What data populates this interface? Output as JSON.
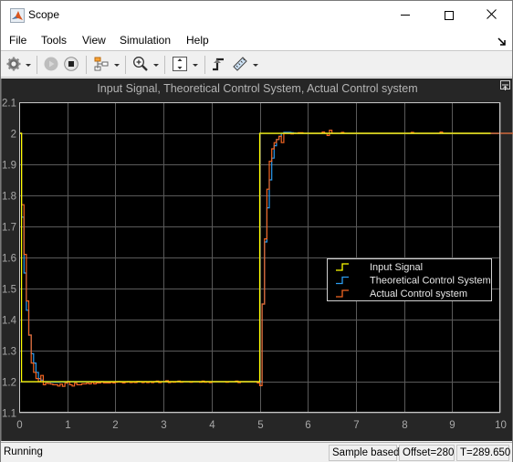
{
  "window": {
    "title": "Scope",
    "icon": "matlab-logo-icon",
    "controls": [
      "minimize",
      "maximize",
      "close"
    ]
  },
  "menubar": {
    "items": [
      {
        "label": "File"
      },
      {
        "label": "Tools"
      },
      {
        "label": "View"
      },
      {
        "label": "Simulation"
      },
      {
        "label": "Help"
      }
    ]
  },
  "toolbar": {
    "buttons": [
      {
        "icon": "settings-gear-icon",
        "dropdown": true
      },
      {
        "icon": "run-play-icon",
        "disabled": true
      },
      {
        "icon": "stop-icon"
      },
      {
        "icon": "signal-selector-icon",
        "dropdown": true
      },
      {
        "icon": "zoom-in-icon",
        "dropdown": true
      },
      {
        "icon": "scale-axes-icon",
        "dropdown": true
      },
      {
        "icon": "triggers-icon"
      },
      {
        "icon": "measurements-ruler-icon",
        "dropdown": true
      }
    ]
  },
  "status": {
    "state": "Running",
    "mode": "Sample based",
    "offset": "Offset=280",
    "time": "T=289.650"
  },
  "chart_data": {
    "type": "line",
    "title": "Input Signal, Theoretical Control System, Actual Control system",
    "xlabel": "",
    "ylabel": "",
    "xlim": [
      0,
      10
    ],
    "ylim": [
      1.1,
      2.1
    ],
    "xticks": [
      "0",
      "1",
      "2",
      "3",
      "4",
      "5",
      "6",
      "7",
      "8",
      "9",
      "10"
    ],
    "yticks": [
      "1.1",
      "1.2",
      "1.3",
      "1.4",
      "1.5",
      "1.6",
      "1.7",
      "1.8",
      "1.9",
      "2",
      "2.1"
    ],
    "grid": true,
    "legend_position": "right-middle",
    "step_style": "stairs",
    "sample_time": 0.05,
    "series": [
      {
        "name": "Input Signal",
        "color": "#ffff00",
        "points": [
          [
            0,
            2.0
          ],
          [
            0.05,
            2.0
          ],
          [
            0.05,
            1.2
          ],
          [
            5.0,
            1.2
          ],
          [
            5.0,
            2.0
          ],
          [
            9.8,
            2.0
          ]
        ]
      },
      {
        "name": "Theoretical Control System",
        "color": "#2b9cf0",
        "start": 0.0,
        "values": [
          2.0,
          1.73,
          1.55,
          1.43,
          1.35,
          1.29,
          1.26,
          1.23,
          1.21,
          1.205,
          1.2,
          1.2,
          1.199,
          1.198,
          1.198,
          1.198,
          1.198,
          1.199,
          1.199,
          1.199,
          1.2,
          1.2,
          1.2,
          1.2,
          1.2,
          1.2,
          1.2,
          1.2,
          1.2,
          1.2,
          1.2,
          1.2,
          1.2,
          1.2,
          1.2,
          1.2,
          1.2,
          1.2,
          1.2,
          1.2,
          1.2,
          1.2,
          1.2,
          1.2,
          1.2,
          1.2,
          1.2,
          1.2,
          1.2,
          1.2,
          1.2,
          1.2,
          1.2,
          1.2,
          1.2,
          1.2,
          1.2,
          1.2,
          1.2,
          1.2,
          1.2,
          1.2,
          1.2,
          1.2,
          1.2,
          1.2,
          1.2,
          1.2,
          1.2,
          1.2,
          1.2,
          1.2,
          1.2,
          1.2,
          1.2,
          1.2,
          1.2,
          1.2,
          1.2,
          1.2,
          1.2,
          1.2,
          1.2,
          1.2,
          1.2,
          1.2,
          1.2,
          1.2,
          1.2,
          1.2,
          1.2,
          1.2,
          1.2,
          1.2,
          1.2,
          1.2,
          1.2,
          1.2,
          1.2,
          1.2,
          1.2,
          1.45,
          1.65,
          1.76,
          1.85,
          1.92,
          1.96,
          1.98,
          1.99,
          2.0,
          2.003,
          2.003,
          2.003,
          2.002,
          2.001,
          2.0,
          2.0,
          2.0,
          2.0,
          2.0,
          2.0,
          2.0,
          2.0,
          2.0,
          2.0,
          2.0,
          2.0,
          2.0,
          2.0,
          2.0,
          2.0,
          2.0,
          2.0,
          2.0,
          2.0,
          2.0,
          2.0,
          2.0,
          2.0,
          2.0,
          2.0,
          2.0,
          2.0,
          2.0,
          2.0,
          2.0,
          2.0,
          2.0,
          2.0,
          2.0,
          2.0,
          2.0,
          2.0,
          2.0,
          2.0,
          2.0,
          2.0,
          2.0,
          2.0,
          2.0,
          2.0,
          2.0,
          2.0,
          2.0,
          2.0,
          2.0,
          2.0,
          2.0,
          2.0,
          2.0,
          2.0,
          2.0,
          2.0,
          2.0,
          2.0,
          2.0,
          2.0,
          2.0,
          2.0,
          2.0,
          2.0,
          2.0,
          2.0,
          2.0,
          2.0,
          2.0,
          2.0,
          2.0,
          2.0,
          2.0,
          2.0,
          2.0,
          2.0,
          2.0,
          2.0,
          2.0,
          2.0,
          2.0,
          2.0,
          2.0,
          2.0,
          2.0,
          2.0,
          2.0,
          2.0,
          2.0,
          2.0
        ]
      },
      {
        "name": "Actual Control system",
        "color": "#f26522",
        "start": 0.0,
        "values": [
          2.0,
          1.77,
          1.61,
          1.46,
          1.35,
          1.26,
          1.23,
          1.21,
          1.2,
          1.22,
          1.19,
          1.195,
          1.194,
          1.192,
          1.19,
          1.19,
          1.186,
          1.192,
          1.185,
          1.195,
          1.2,
          1.19,
          1.186,
          1.195,
          1.19,
          1.19,
          1.193,
          1.193,
          1.195,
          1.193,
          1.198,
          1.193,
          1.196,
          1.196,
          1.2,
          1.196,
          1.196,
          1.196,
          1.198,
          1.196,
          1.198,
          1.2,
          1.198,
          1.196,
          1.198,
          1.2,
          1.197,
          1.198,
          1.197,
          1.201,
          1.2,
          1.197,
          1.2,
          1.197,
          1.2,
          1.197,
          1.2,
          1.202,
          1.197,
          1.2,
          1.2,
          1.203,
          1.197,
          1.2,
          1.198,
          1.2,
          1.202,
          1.198,
          1.2,
          1.2,
          1.2,
          1.198,
          1.2,
          1.2,
          1.2,
          1.198,
          1.202,
          1.198,
          1.2,
          1.197,
          1.2,
          1.2,
          1.2,
          1.2,
          1.2,
          1.2,
          1.198,
          1.2,
          1.2,
          1.2,
          1.202,
          1.197,
          1.2,
          1.2,
          1.2,
          1.2,
          1.2,
          1.2,
          1.2,
          1.196,
          1.187,
          1.45,
          1.66,
          1.82,
          1.91,
          1.95,
          1.97,
          1.98,
          1.99,
          1.97,
          2.0,
          2.0,
          2.0,
          1.998,
          2.0,
          2.0,
          2.002,
          2.002,
          2.0,
          2.0,
          2.0,
          2.0,
          2.0,
          2.0,
          2.0,
          2.0,
          2.004,
          2.0,
          1.993,
          2.01,
          2.0,
          2.0,
          2.0,
          2.0,
          2.003,
          2.0,
          2.0,
          2.0,
          2.0,
          2.0,
          2.0,
          2.0,
          2.0,
          2.0,
          2.0,
          2.0,
          2.0,
          2.0,
          2.0,
          2.0,
          2.0,
          2.0,
          2.0,
          2.0,
          2.0,
          2.0,
          2.0,
          2.0,
          2.0,
          2.0,
          2.0,
          2.0,
          2.0,
          2.003,
          2.0,
          2.0,
          2.0,
          2.0,
          2.0,
          2.0,
          2.0,
          2.0,
          2.0,
          2.0,
          2.0,
          2.004,
          2.0,
          2.0,
          2.0,
          2.0,
          2.0,
          2.0,
          2.0,
          2.0,
          2.0,
          2.0,
          2.0,
          2.0,
          2.0,
          2.0,
          2.0,
          2.0,
          2.0,
          2.0,
          2.0,
          2.0,
          2.0,
          2.0,
          2.0,
          2.0,
          2.0,
          2.0,
          2.0,
          2.0,
          2.0,
          2.0,
          2.0,
          2.0,
          2.0,
          2.0,
          2.0,
          2.0,
          2.0,
          2.0,
          2.0,
          2.0,
          2.0,
          2.0,
          2.0,
          2.0,
          2.0,
          2.0,
          2.0,
          2.0,
          2.0,
          2.0,
          2.0,
          2.0,
          2.0,
          2.0
        ]
      }
    ]
  }
}
